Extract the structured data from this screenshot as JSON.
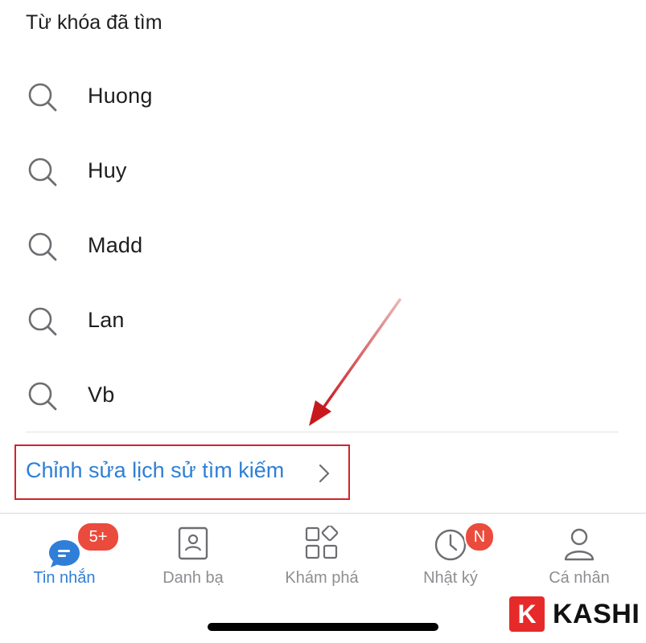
{
  "section": {
    "title": "Từ khóa đã tìm"
  },
  "history": [
    {
      "label": "Huong",
      "icon": "search-icon"
    },
    {
      "label": "Huy",
      "icon": "search-icon"
    },
    {
      "label": "Madd",
      "icon": "search-icon"
    },
    {
      "label": "Lan",
      "icon": "search-icon"
    },
    {
      "label": "Vb",
      "icon": "search-icon"
    }
  ],
  "edit_history": {
    "label": "Chỉnh sửa lịch sử tìm kiếm",
    "color": "#2e7fd6",
    "highlight_color": "#d2232a"
  },
  "tabs": [
    {
      "label": "Tin nhắn",
      "icon": "chat-bubble-icon",
      "active": true,
      "badge": "5+"
    },
    {
      "label": "Danh bạ",
      "icon": "contact-card-icon",
      "active": false
    },
    {
      "label": "Khám phá",
      "icon": "apps-grid-icon",
      "active": false
    },
    {
      "label": "Nhật ký",
      "icon": "clock-icon",
      "active": false,
      "badge": "N"
    },
    {
      "label": "Cá nhân",
      "icon": "person-icon",
      "active": false
    }
  ],
  "colors": {
    "accent": "#2f7fd8",
    "badge": "#ea4b3c",
    "inactive": "#8e8e93"
  },
  "watermark": {
    "letter": "K",
    "text": "KASHI"
  }
}
